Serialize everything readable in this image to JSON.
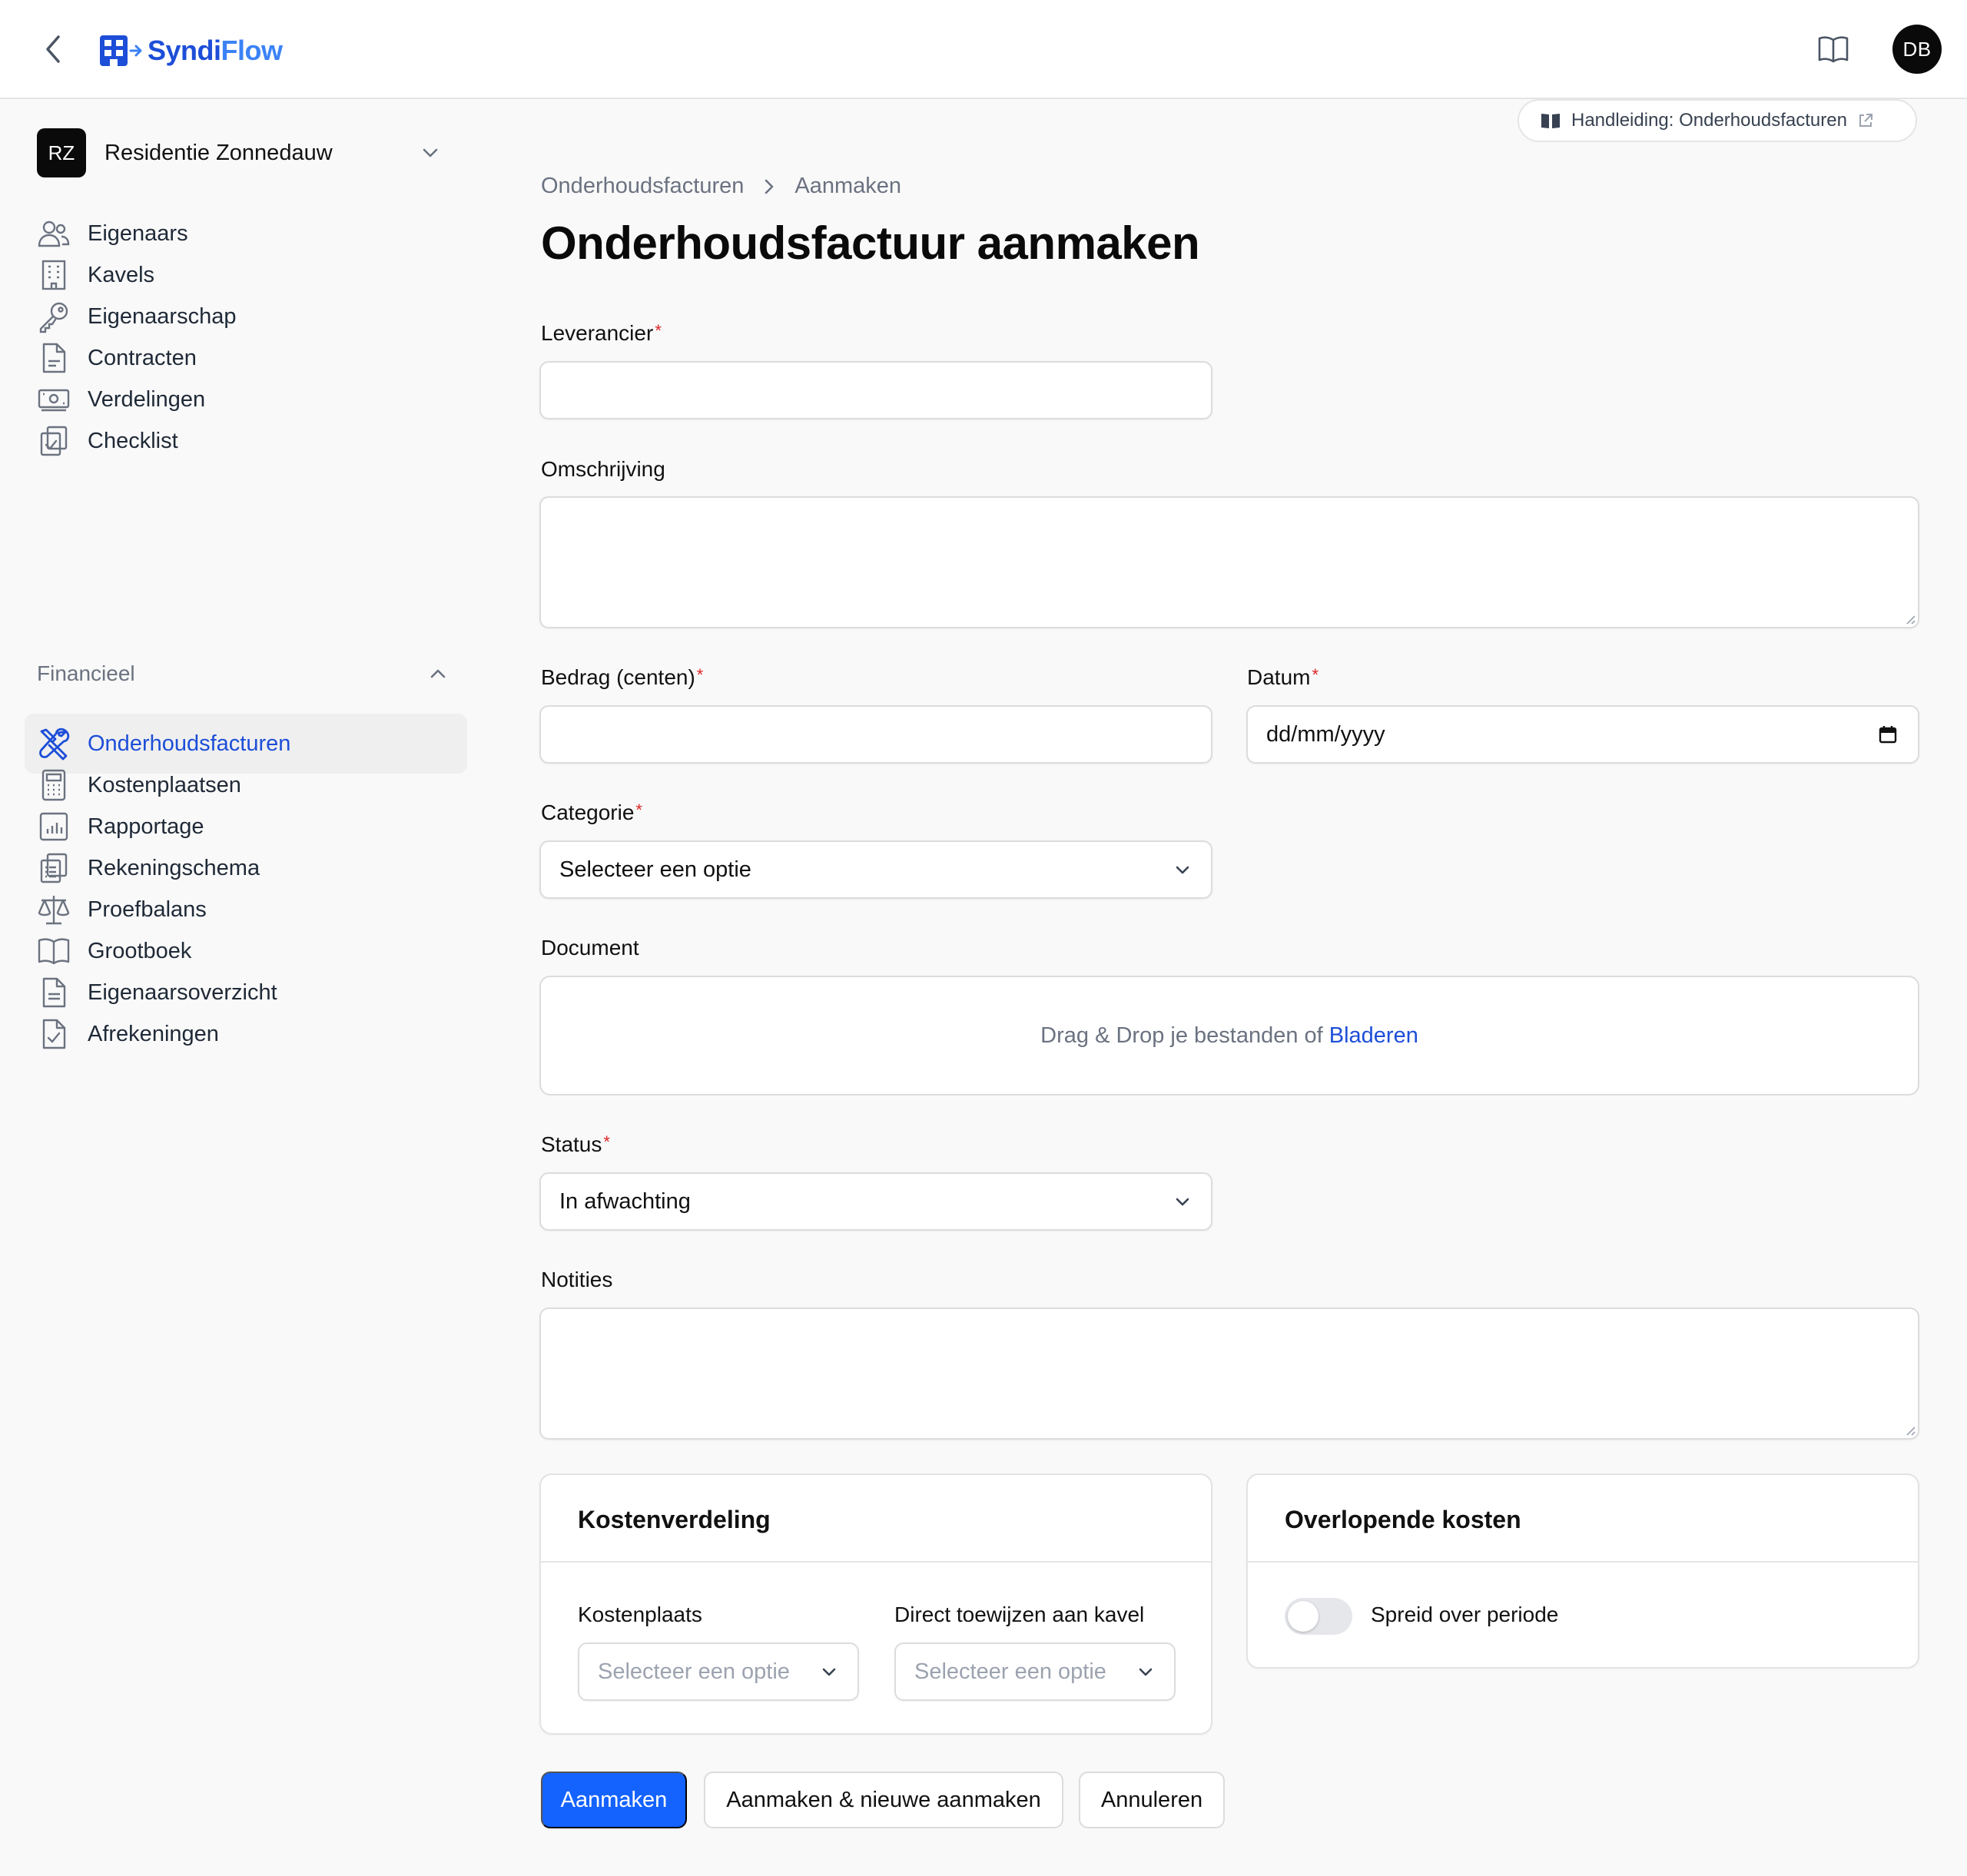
{
  "app": {
    "logo_name_a": "Syndi",
    "logo_name_b": "Flow"
  },
  "user": {
    "initials": "DB"
  },
  "tenant": {
    "badge": "RZ",
    "name": "Residentie Zonnedauw"
  },
  "sidebar": {
    "items": [
      {
        "label": "Eigenaars",
        "icon": "users-icon"
      },
      {
        "label": "Kavels",
        "icon": "building-icon"
      },
      {
        "label": "Eigenaarschap",
        "icon": "key-icon"
      },
      {
        "label": "Contracten",
        "icon": "document-icon"
      },
      {
        "label": "Verdelingen",
        "icon": "banknote-icon"
      },
      {
        "label": "Checklist",
        "icon": "clipboard-check-icon"
      }
    ],
    "financial_group": "Financieel",
    "financial_items": [
      {
        "label": "Onderhoudsfacturen",
        "icon": "wrench-screwdriver-icon",
        "active": true
      },
      {
        "label": "Kostenplaatsen",
        "icon": "calculator-icon"
      },
      {
        "label": "Rapportage",
        "icon": "chart-bar-icon"
      },
      {
        "label": "Rekeningschema",
        "icon": "clipboard-list-icon"
      },
      {
        "label": "Proefbalans",
        "icon": "scale-icon"
      },
      {
        "label": "Grootboek",
        "icon": "book-open-icon"
      },
      {
        "label": "Eigenaarsoverzicht",
        "icon": "document-text-icon"
      },
      {
        "label": "Afrekeningen",
        "icon": "document-check-icon"
      }
    ]
  },
  "guide": {
    "label": "Handleiding: Onderhoudsfacturen"
  },
  "breadcrumb": {
    "parent": "Onderhoudsfacturen",
    "current": "Aanmaken"
  },
  "page": {
    "title": "Onderhoudsfactuur aanmaken"
  },
  "form": {
    "supplier": {
      "label": "Leverancier",
      "value": ""
    },
    "description": {
      "label": "Omschrijving",
      "value": ""
    },
    "amount": {
      "label": "Bedrag (centen)",
      "value": ""
    },
    "date": {
      "label": "Datum",
      "placeholder": "dd/mm/yyyy"
    },
    "category": {
      "label": "Categorie",
      "value": "Selecteer een optie"
    },
    "document": {
      "label": "Document",
      "drop_text": "Drag & Drop je bestanden of",
      "browse": "Bladeren"
    },
    "status": {
      "label": "Status",
      "value": "In afwachting"
    },
    "notes": {
      "label": "Notities",
      "value": ""
    },
    "required_mark": "*"
  },
  "cost_allocation": {
    "title": "Kostenverdeling",
    "cost_center_label": "Kostenplaats",
    "cost_center_value": "Selecteer een optie",
    "direct_assign_label": "Direct toewijzen aan kavel",
    "direct_assign_value": "Selecteer een optie"
  },
  "accrued_costs": {
    "title": "Overlopende kosten",
    "toggle_label": "Spreid over periode",
    "toggle_on": false
  },
  "actions": {
    "create": "Aanmaken",
    "create_and_new": "Aanmaken & nieuwe aanmaken",
    "cancel": "Annuleren"
  },
  "colors": {
    "primary": "#1463ff",
    "active_nav": "#1d4ed8",
    "required": "#dc2626"
  }
}
